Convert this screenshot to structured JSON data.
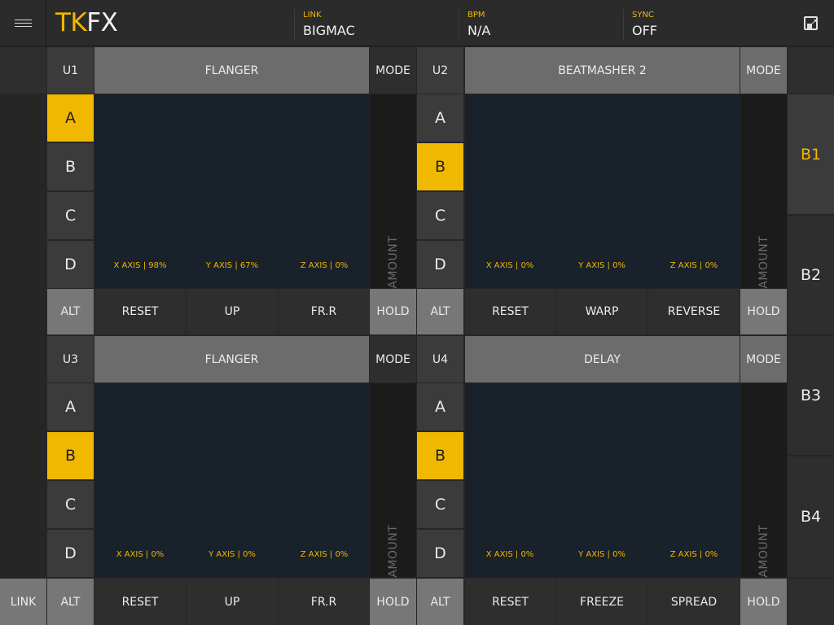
{
  "header": {
    "logo_tk": "TK",
    "logo_fx": "FX",
    "link_label": "LINK",
    "link_value": "BIGMAC",
    "bpm_label": "BPM",
    "bpm_value": "N/A",
    "sync_label": "SYNC",
    "sync_value": "OFF",
    "menu_icon": "hamburger-icon",
    "expand_icon": "fullscreen-icon"
  },
  "units": {
    "u1": {
      "id": "U1",
      "effect": "FLANGER",
      "mode": "MODE",
      "slots": [
        "A",
        "B",
        "C",
        "D"
      ],
      "active_slot": "A",
      "x_axis": "X AXIS | 98%",
      "y_axis": "Y AXIS | 67%",
      "z_axis": "Z AXIS | 0%",
      "fx_amount": "FX AMOUNT",
      "alt": "ALT",
      "b1": "RESET",
      "b2": "UP",
      "b3": "FR.R",
      "hold": "HOLD"
    },
    "u2": {
      "id": "U2",
      "effect": "BEATMASHER 2",
      "mode": "MODE",
      "slots": [
        "A",
        "B",
        "C",
        "D"
      ],
      "active_slot": "B",
      "x_axis": "X AXIS | 0%",
      "y_axis": "Y AXIS | 0%",
      "z_axis": "Z AXIS | 0%",
      "fx_amount": "FX AMOUNT",
      "alt": "ALT",
      "b1": "RESET",
      "b2": "WARP",
      "b3": "REVERSE",
      "hold": "HOLD"
    },
    "u3": {
      "id": "U3",
      "effect": "FLANGER",
      "mode": "MODE",
      "slots": [
        "A",
        "B",
        "C",
        "D"
      ],
      "active_slot": "B",
      "x_axis": "X AXIS | 0%",
      "y_axis": "Y AXIS | 0%",
      "z_axis": "Z AXIS | 0%",
      "fx_amount": "FX AMOUNT",
      "alt": "ALT",
      "b1": "RESET",
      "b2": "UP",
      "b3": "FR.R",
      "hold": "HOLD"
    },
    "u4": {
      "id": "U4",
      "effect": "DELAY",
      "mode": "MODE",
      "slots": [
        "A",
        "B",
        "C",
        "D"
      ],
      "active_slot": "B",
      "x_axis": "X AXIS | 0%",
      "y_axis": "Y AXIS | 0%",
      "z_axis": "Z AXIS | 0%",
      "fx_amount": "FX AMOUNT",
      "alt": "ALT",
      "b1": "RESET",
      "b2": "FREEZE",
      "b3": "SPREAD",
      "hold": "HOLD"
    }
  },
  "banks": [
    "B1",
    "B2",
    "B3",
    "B4"
  ],
  "active_bank": "B1",
  "footer": {
    "link": "LINK"
  },
  "colors": {
    "accent": "#f0b800",
    "pad": "#19212b"
  }
}
